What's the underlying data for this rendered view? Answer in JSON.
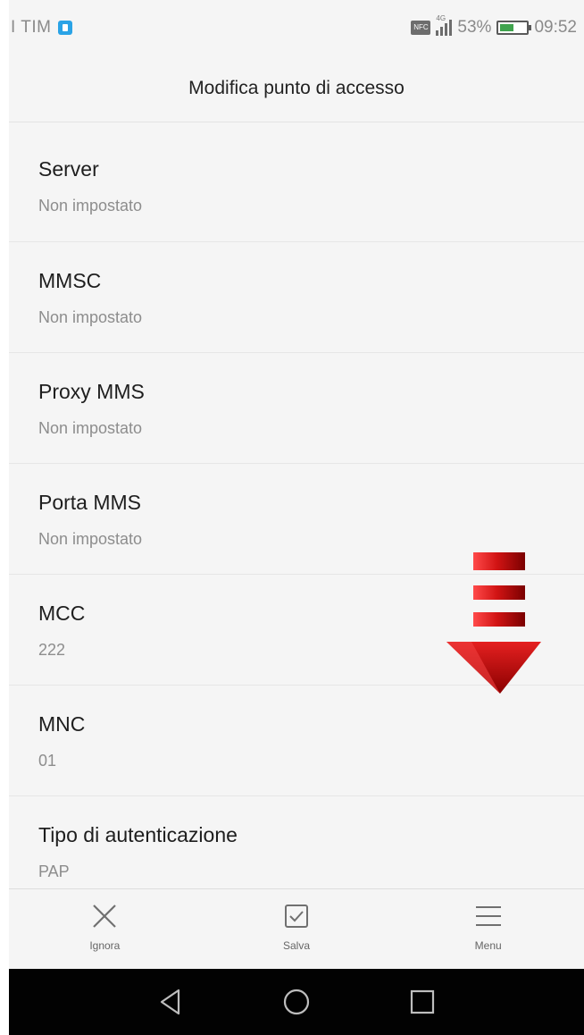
{
  "status_bar": {
    "carrier": "I TIM",
    "network": "4G",
    "battery_percent": "53%",
    "time": "09:52",
    "battery_level": 0.53
  },
  "header": {
    "title": "Modifica punto di accesso"
  },
  "settings": {
    "items": [
      {
        "title": "Server",
        "value": "Non impostato"
      },
      {
        "title": "MMSC",
        "value": "Non impostato"
      },
      {
        "title": "Proxy MMS",
        "value": "Non impostato"
      },
      {
        "title": "Porta MMS",
        "value": "Non impostato"
      },
      {
        "title": "MCC",
        "value": "222"
      },
      {
        "title": "MNC",
        "value": "01"
      },
      {
        "title": "Tipo di autenticazione",
        "value": "PAP"
      }
    ]
  },
  "overlay": {
    "arrow_icon": "red-down-arrow",
    "arrow_color": "#d21414"
  },
  "action_bar": {
    "ignore_label": "Ignora",
    "save_label": "Salva",
    "menu_label": "Menu",
    "ignore_icon": "close-icon",
    "save_icon": "checkbox-icon",
    "menu_icon": "menu-icon"
  },
  "nav_bar": {
    "back_icon": "back-icon",
    "home_icon": "home-icon",
    "recents_icon": "recents-icon"
  }
}
